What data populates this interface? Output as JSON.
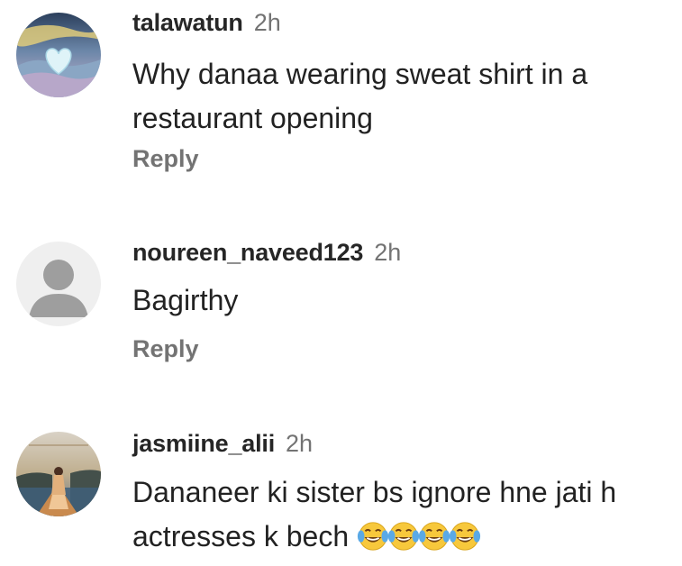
{
  "comments": [
    {
      "avatar_icon": "landscape-heart-avatar",
      "username": "talawatun",
      "time": "2h",
      "lines": [
        "Why danaa wearing sweat shirt in a",
        "restaurant opening"
      ],
      "reply_label": "Reply"
    },
    {
      "avatar_icon": "default-user-avatar",
      "username": "noureen_naveed123",
      "time": "2h",
      "lines": [
        "Bagirthy"
      ],
      "reply_label": "Reply"
    },
    {
      "avatar_icon": "sunset-girl-avatar",
      "username": "jasmiine_alii",
      "time": "2h",
      "lines": [
        "Dananeer ki sister bs ignore hne jati h",
        "actresses k bech"
      ],
      "emojis": [
        "face-with-tears-of-joy",
        "face-with-tears-of-joy",
        "face-with-tears-of-joy",
        "face-with-tears-of-joy"
      ]
    }
  ],
  "colors": {
    "username": "#262626",
    "secondary_text": "#737373",
    "body_text": "#222222",
    "emoji_face": "#f7c83c",
    "emoji_tears": "#5aa9e6"
  }
}
